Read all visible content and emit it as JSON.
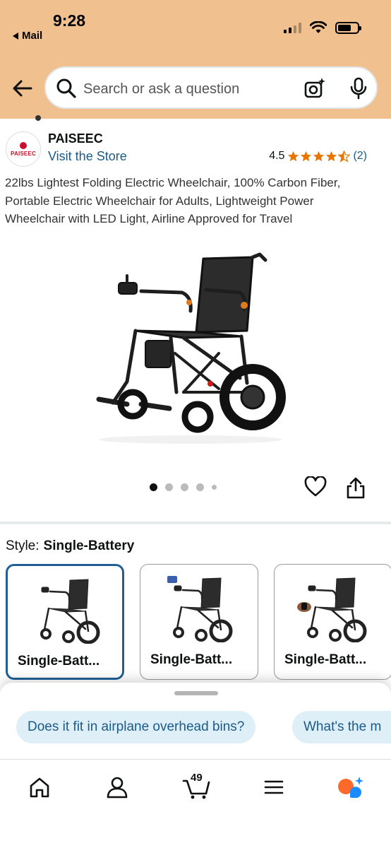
{
  "status_bar": {
    "time": "9:28",
    "back_app": "Mail"
  },
  "search": {
    "placeholder": "Search or ask a question"
  },
  "store": {
    "brand": "PAISEEC",
    "logo_text": "PAISEEC",
    "visit_link": "Visit the Store",
    "rating": "4.5",
    "rating_count": "(2)"
  },
  "product": {
    "title": "22lbs Lightest Folding Electric Wheelchair, 100% Carbon Fiber, Portable Electric Wheelchair for Adults, Lightweight Power Wheelchair with LED Light, Airline Approved for Travel",
    "image_count": 5,
    "active_image": 1
  },
  "style": {
    "label": "Style:",
    "value": "Single-Battery",
    "options": [
      {
        "label": "Single-Batt..."
      },
      {
        "label": "Single-Batt..."
      },
      {
        "label": "Single-Batt..."
      }
    ]
  },
  "suggestions": [
    "Does it fit in airplane overhead bins?",
    "What's the m"
  ],
  "nav": {
    "cart_count": "49"
  },
  "colors": {
    "header_bg": "#f0c08f",
    "link": "#1b5b8a",
    "star": "#e77600",
    "selected_border": "#1f5f96",
    "chip_bg": "#dfeff8",
    "ai_orange": "#ff6a2a",
    "ai_blue": "#1a8cff"
  }
}
